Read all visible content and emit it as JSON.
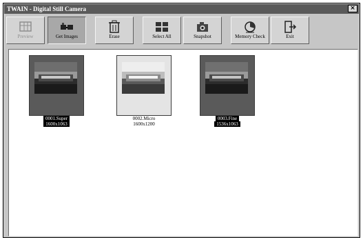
{
  "window": {
    "title": "TWAIN - Digital Still Camera",
    "close_glyph": "×"
  },
  "toolbar": {
    "buttons": [
      {
        "label": "Preview",
        "icon": "preview-icon",
        "state": "disabled"
      },
      {
        "label": "Get Images",
        "icon": "get-images-icon",
        "state": "active"
      },
      {
        "label": "Erase",
        "icon": "erase-icon",
        "state": "normal"
      },
      {
        "label": "Select All",
        "icon": "select-all-icon",
        "state": "normal"
      },
      {
        "label": "Snapshot",
        "icon": "snapshot-icon",
        "state": "normal"
      },
      {
        "label": "Memory Check",
        "icon": "memory-check-icon",
        "state": "normal"
      },
      {
        "label": "Exit",
        "icon": "exit-icon",
        "state": "normal"
      }
    ]
  },
  "thumbnails": [
    {
      "name": "0001.Super",
      "size": "1600x1063",
      "selected": true
    },
    {
      "name": "0002.Micro",
      "size": "1600x1200",
      "selected": false
    },
    {
      "name": "0003.Fine",
      "size": "1536x1063",
      "selected": true
    }
  ],
  "colors": {
    "selected_frame": "#5a5a5a",
    "unselected_frame": "#e4e4e4"
  }
}
